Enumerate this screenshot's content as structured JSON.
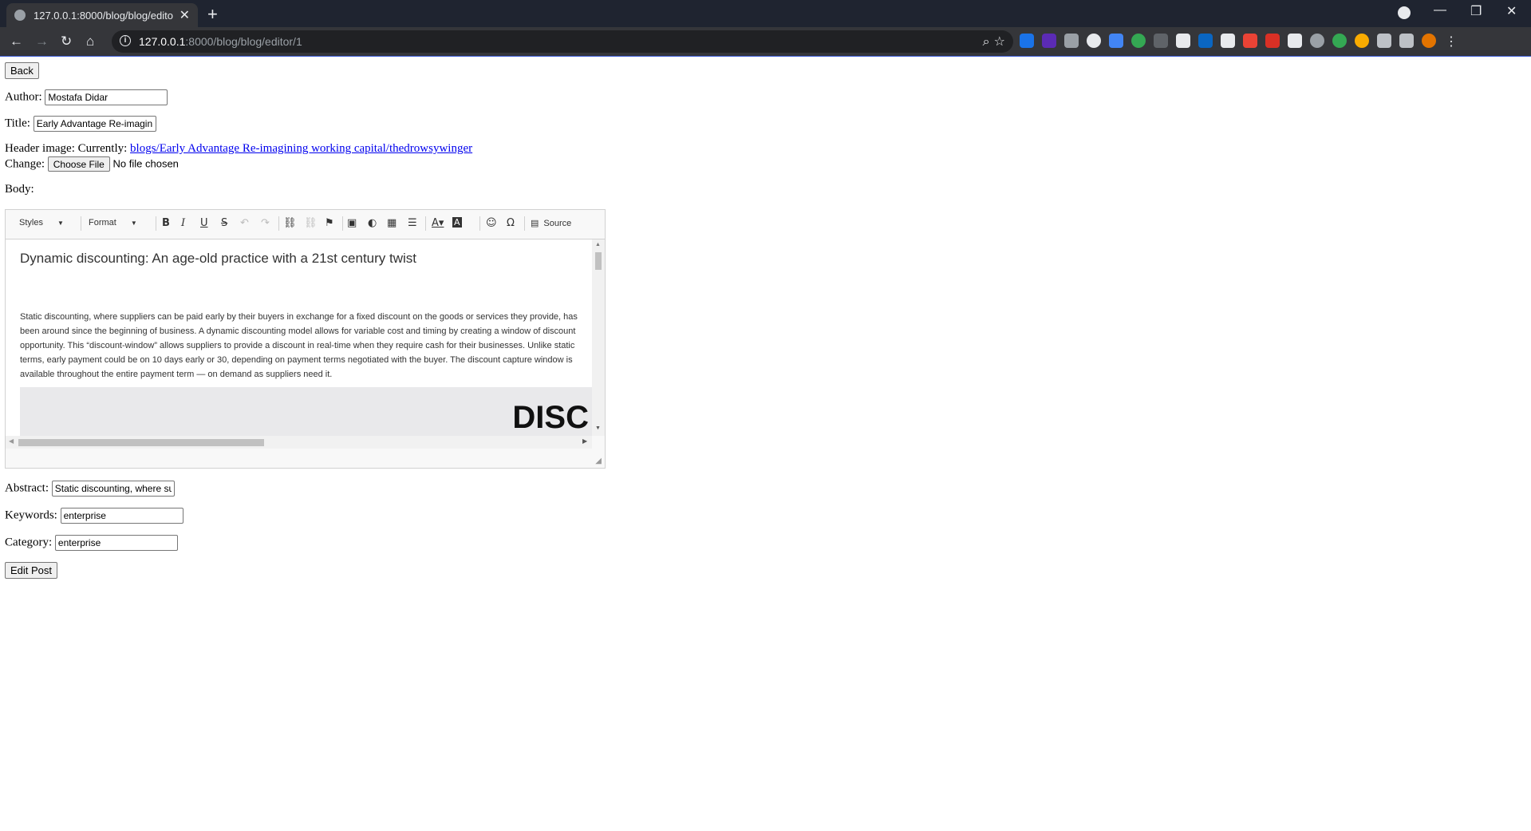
{
  "browser": {
    "tab_title": "127.0.0.1:8000/blog/blog/editor/",
    "url_host": "127.0.0.1",
    "url_path": ":8000/blog/blog/editor/1"
  },
  "form": {
    "back_label": "Back",
    "author_label": "Author:",
    "author_value": "Mostafa Didar",
    "title_label": "Title:",
    "title_value": "Early Advantage Re-imagin",
    "header_image_label": "Header image:",
    "currently_label": "Currently:",
    "header_image_link": "blogs/Early Advantage Re-imagining working capital/thedrowsywinger",
    "change_label": "Change:",
    "choose_file_label": "Choose File",
    "no_file_label": "No file chosen",
    "body_label": "Body:",
    "abstract_label": "Abstract:",
    "abstract_value": "Static discounting, where su",
    "keywords_label": "Keywords:",
    "keywords_value": "enterprise",
    "category_label": "Category:",
    "category_value": "enterprise",
    "submit_label": "Edit Post"
  },
  "editor": {
    "styles_label": "Styles",
    "format_label": "Format",
    "source_label": "Source",
    "heading": "Dynamic discounting: An age-old practice with a 21st century twist",
    "paragraph": "Static discounting, where suppliers can be paid early by their buyers in exchange for a fixed discount on the goods or services they provide, has been around since the beginning of business. A dynamic discounting model allows for variable cost and timing by creating a window of discount opportunity. This “discount-window” allows suppliers to provide a discount in real-time when they require cash for their businesses. Unlike static terms, early payment could be on 10 days early or 30, depending on payment terms negotiated with the buyer. The discount capture window is available throughout the entire payment term — on demand as suppliers need it.",
    "image_text": "DISC"
  }
}
